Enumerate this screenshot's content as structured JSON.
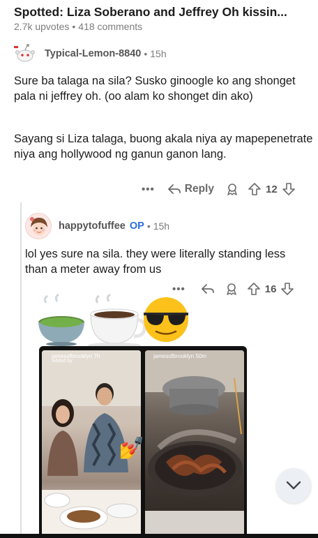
{
  "post": {
    "title": "Spotted: Liza Soberano and Jeffrey Oh kissin...",
    "upvotes": "2.7k upvotes",
    "comments": "418 comments",
    "separator": "•"
  },
  "comment1": {
    "author": "Typical-Lemon-8840",
    "separator": "•",
    "time": "15h",
    "paragraph1": "Sure ba talaga na sila? Susko ginoogle ko ang shonget pala ni jeffrey oh. (oo alam ko shonget din ako)",
    "paragraph2": "Sayang si Liza talaga, buong akala niya ay mapepenetrate niya ang hollywood ng ganun ganon lang.",
    "more_label": "•••",
    "reply_label": "Reply",
    "vote_count": "12"
  },
  "comment2": {
    "author": "happytofuffee",
    "op_badge": "OP",
    "separator": "•",
    "time": "15h",
    "text": "lol yes sure na sila. they were literally standing less than a meter away from us",
    "more_label": "•••",
    "vote_count": "16"
  },
  "emojis": {
    "items": [
      "🍵",
      "☕",
      "😎"
    ]
  },
  "photo": {
    "left_tag": "jamesofbrooklyn  7h",
    "left_sub": "Added by",
    "right_tag": "jamesofbrooklyn  50m",
    "sticker": "💅"
  },
  "colors": {
    "op_blue": "#2a6fdb",
    "meta_gray": "#7c7c7c",
    "thread_line": "#dedede"
  },
  "icons": [
    "snoo-avatar",
    "reply-arrow-icon",
    "award-icon",
    "upvote-icon",
    "downvote-icon",
    "chevron-down-icon"
  ]
}
